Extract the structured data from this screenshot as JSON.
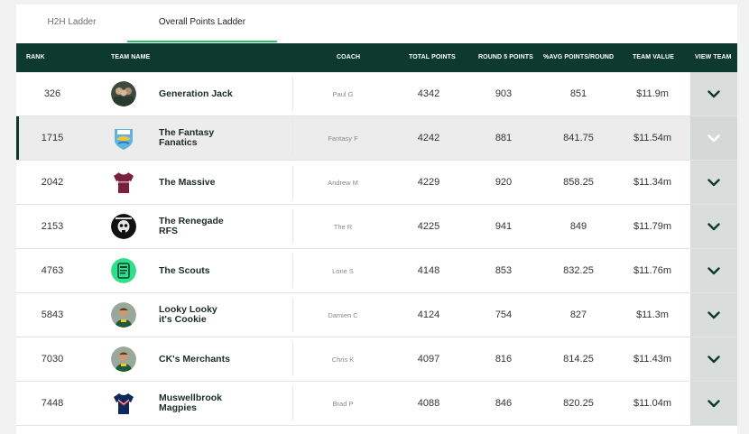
{
  "tabs": [
    {
      "label": "H2H Ladder",
      "active": false
    },
    {
      "label": "Overall Points Ladder",
      "active": true
    }
  ],
  "columns": {
    "rank": "RANK",
    "team_name": "TEAM NAME",
    "coach": "COACH",
    "total_points": "TOTAL POINTS",
    "round_points": "ROUND 5 POINTS",
    "avg_points": "%AVG POINTS/ROUND",
    "team_value": "TEAM VALUE",
    "view_team": "VIEW TEAM"
  },
  "colors": {
    "header_bg": "#0e3a2d",
    "tab_underline": "#29c46b",
    "view_col_bg": "#d9dedc",
    "chevron": "#0e3a2d"
  },
  "rows": [
    {
      "rank": "326",
      "team_line1": "Generation Jack",
      "team_line2": "",
      "coach": "Paul G",
      "total": "4342",
      "round": "903",
      "avg": "851",
      "value": "$11.9m",
      "avatar_icon": "team-photo-icon",
      "highlight": false,
      "chevron_color": "#0e3a2d"
    },
    {
      "rank": "1715",
      "team_line1": "The Fantasy",
      "team_line2": "Fanatics",
      "coach": "Fantasy F",
      "total": "4242",
      "round": "881",
      "avg": "841.75",
      "value": "$11.54m",
      "avatar_icon": "eels-logo-icon",
      "highlight": true,
      "chevron_color": "#ffffff"
    },
    {
      "rank": "2042",
      "team_line1": "The Massive",
      "team_line2": "",
      "coach": "Andrew M",
      "total": "4229",
      "round": "920",
      "avg": "858.25",
      "value": "$11.34m",
      "avatar_icon": "maroon-jersey-icon",
      "highlight": false,
      "chevron_color": "#0e3a2d"
    },
    {
      "rank": "2153",
      "team_line1": "The Renegade",
      "team_line2": "RFS",
      "coach": "The R",
      "total": "4225",
      "round": "941",
      "avg": "849",
      "value": "$11.79m",
      "avatar_icon": "skull-logo-icon",
      "highlight": false,
      "chevron_color": "#0e3a2d"
    },
    {
      "rank": "4763",
      "team_line1": "The Scouts",
      "team_line2": "",
      "coach": "Lone S",
      "total": "4148",
      "round": "853",
      "avg": "832.25",
      "value": "$11.76m",
      "avatar_icon": "green-badge-icon",
      "highlight": false,
      "chevron_color": "#0e3a2d"
    },
    {
      "rank": "5843",
      "team_line1": "Looky Looky",
      "team_line2": "it's Cookie",
      "coach": "Damien C",
      "total": "4124",
      "round": "754",
      "avg": "827",
      "value": "$11.3m",
      "avatar_icon": "player-photo-icon",
      "highlight": false,
      "chevron_color": "#0e3a2d"
    },
    {
      "rank": "7030",
      "team_line1": "CK's Merchants",
      "team_line2": "",
      "coach": "Chris K",
      "total": "4097",
      "round": "816",
      "avg": "814.25",
      "value": "$11.43m",
      "avatar_icon": "player-photo-icon",
      "highlight": false,
      "chevron_color": "#0e3a2d"
    },
    {
      "rank": "7448",
      "team_line1": "Muswellbrook",
      "team_line2": "Magpies",
      "coach": "Brad P",
      "total": "4088",
      "round": "846",
      "avg": "820.25",
      "value": "$11.04m",
      "avatar_icon": "roosters-jersey-icon",
      "highlight": false,
      "chevron_color": "#0e3a2d"
    }
  ]
}
